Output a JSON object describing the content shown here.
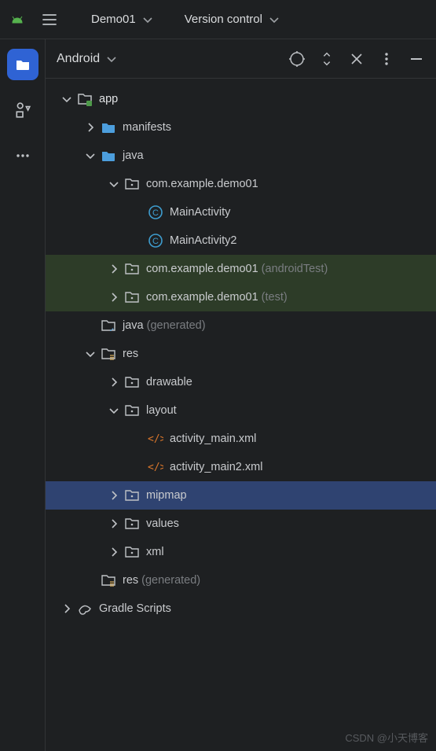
{
  "menubar": {
    "items": [
      {
        "label": "Demo01"
      },
      {
        "label": "Version control"
      }
    ]
  },
  "panel": {
    "title": "Android"
  },
  "icons": {
    "target": "target-icon",
    "expand": "expand-collapse-icon",
    "close": "close-icon",
    "more": "more-vert-icon",
    "minimize": "minimize-icon"
  },
  "tree": [
    {
      "depth": 0,
      "twisty": "down",
      "icon": "module",
      "label": "app",
      "labelClass": "app",
      "name": "node-app"
    },
    {
      "depth": 1,
      "twisty": "right",
      "icon": "folder-b",
      "label": "manifests",
      "name": "node-manifests"
    },
    {
      "depth": 1,
      "twisty": "down",
      "icon": "folder-b",
      "label": "java",
      "name": "node-java"
    },
    {
      "depth": 2,
      "twisty": "down",
      "icon": "pkg",
      "label": "com.example.demo01",
      "name": "node-pkg-main"
    },
    {
      "depth": 3,
      "twisty": "",
      "icon": "class",
      "label": "MainActivity",
      "name": "node-mainactivity"
    },
    {
      "depth": 3,
      "twisty": "",
      "icon": "class",
      "label": "MainActivity2",
      "name": "node-mainactivity2"
    },
    {
      "depth": 2,
      "twisty": "right",
      "icon": "pkg",
      "label": "com.example.demo01",
      "suffix": "(androidTest)",
      "hl": "green",
      "name": "node-pkg-androidtest"
    },
    {
      "depth": 2,
      "twisty": "right",
      "icon": "pkg",
      "label": "com.example.demo01",
      "suffix": "(test)",
      "hl": "green",
      "name": "node-pkg-test"
    },
    {
      "depth": 1,
      "twisty": "",
      "icon": "folder-gen",
      "label": "java",
      "suffix": "(generated)",
      "name": "node-java-generated"
    },
    {
      "depth": 1,
      "twisty": "down",
      "icon": "folder-res",
      "label": "res",
      "name": "node-res"
    },
    {
      "depth": 2,
      "twisty": "right",
      "icon": "pkg",
      "label": "drawable",
      "name": "node-drawable"
    },
    {
      "depth": 2,
      "twisty": "down",
      "icon": "pkg",
      "label": "layout",
      "name": "node-layout"
    },
    {
      "depth": 3,
      "twisty": "",
      "icon": "xml",
      "label": "activity_main.xml",
      "name": "node-activity-main"
    },
    {
      "depth": 3,
      "twisty": "",
      "icon": "xml",
      "label": "activity_main2.xml",
      "name": "node-activity-main2"
    },
    {
      "depth": 2,
      "twisty": "right",
      "icon": "pkg",
      "label": "mipmap",
      "hl": "blue",
      "name": "node-mipmap"
    },
    {
      "depth": 2,
      "twisty": "right",
      "icon": "pkg",
      "label": "values",
      "name": "node-values"
    },
    {
      "depth": 2,
      "twisty": "right",
      "icon": "pkg",
      "label": "xml",
      "name": "node-xml"
    },
    {
      "depth": 1,
      "twisty": "",
      "icon": "folder-res",
      "label": "res",
      "suffix": "(generated)",
      "name": "node-res-generated"
    },
    {
      "depth": 0,
      "twisty": "right",
      "icon": "gradle",
      "label": "Gradle Scripts",
      "name": "node-gradle-scripts"
    }
  ],
  "watermark": "CSDN @小天博客"
}
